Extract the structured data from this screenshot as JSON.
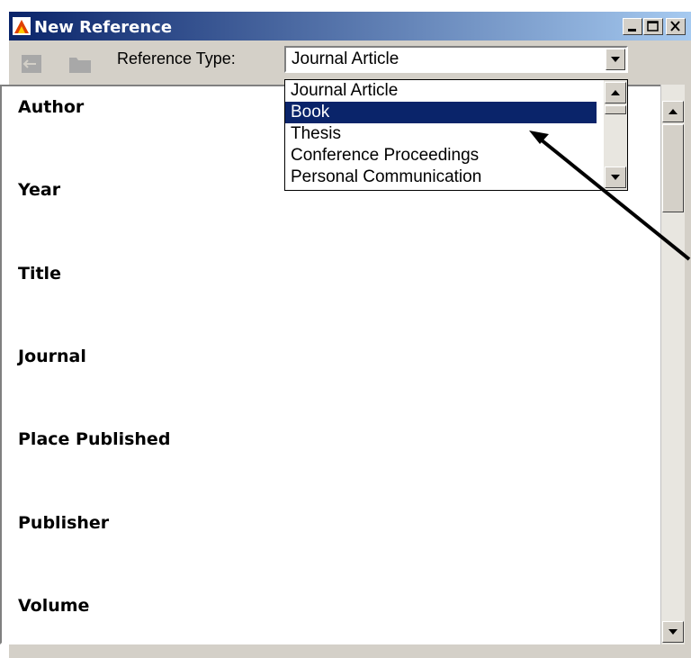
{
  "window": {
    "title": "New Reference"
  },
  "toolbar": {
    "reference_type_label": "Reference Type:",
    "reference_type_value": "Journal Article"
  },
  "dropdown": {
    "items": [
      "Journal Article",
      "Book",
      "Thesis",
      "Conference Proceedings",
      "Personal Communication"
    ],
    "selected_item": "Book"
  },
  "form": {
    "fields": [
      "Author",
      "Year",
      "Title",
      "Journal",
      "Place Published",
      "Publisher",
      "Volume"
    ]
  },
  "colors": {
    "titlebar_start": "#0a246a",
    "titlebar_end": "#a6caf0",
    "selection": "#0a246a",
    "window_face": "#d4d0c8"
  },
  "icons": [
    "app-icon",
    "minimize-icon",
    "maximize-icon",
    "close-icon",
    "back-icon",
    "folder-icon",
    "dropdown-arrow-icon",
    "scroll-up-icon",
    "scroll-down-icon",
    "annotation-arrow"
  ]
}
